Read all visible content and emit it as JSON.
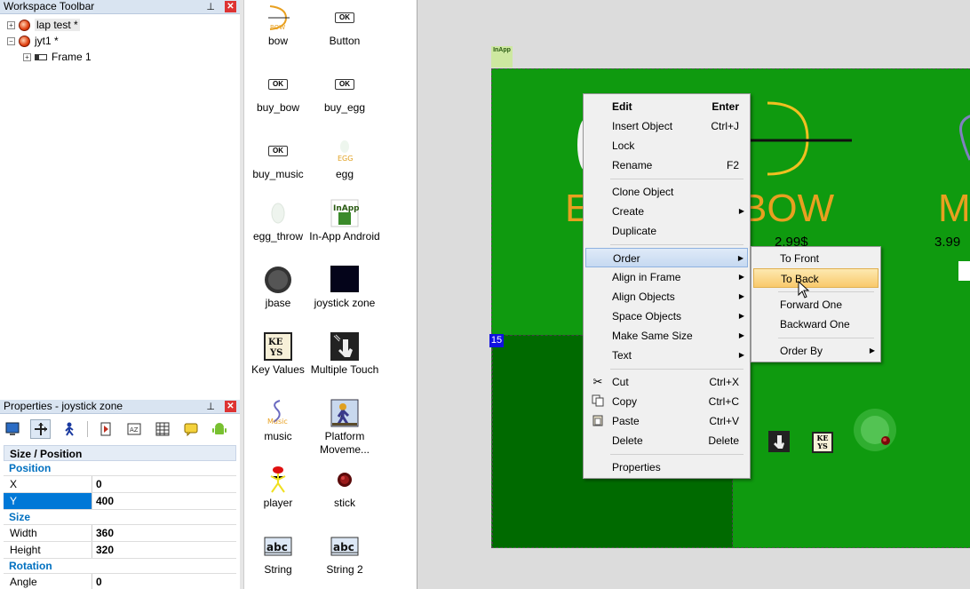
{
  "workspace": {
    "title": "Workspace Toolbar",
    "pin": "⊥",
    "close": "✕",
    "tree": [
      {
        "label": "lap test *",
        "expander": "+"
      },
      {
        "label": "jyt1 *",
        "expander": "−"
      },
      {
        "label": "Frame 1",
        "expander": "+"
      }
    ]
  },
  "properties": {
    "title": "Properties - joystick zone",
    "header": "Size / Position",
    "sections": {
      "position": "Position",
      "size": "Size",
      "rotation": "Rotation"
    },
    "rows": {
      "x": {
        "name": "X",
        "value": "0"
      },
      "y": {
        "name": "Y",
        "value": "400"
      },
      "width": {
        "name": "Width",
        "value": "360"
      },
      "height": {
        "name": "Height",
        "value": "320"
      },
      "angle": {
        "name": "Angle",
        "value": "0"
      }
    }
  },
  "library": {
    "items": [
      {
        "label": "bow",
        "icon": "bow-icon"
      },
      {
        "label": "Button",
        "icon": "button-icon"
      },
      {
        "label": "buy_bow",
        "icon": "button-icon"
      },
      {
        "label": "buy_egg",
        "icon": "button-icon"
      },
      {
        "label": "buy_music",
        "icon": "button-icon"
      },
      {
        "label": "egg",
        "icon": "egg-icon"
      },
      {
        "label": "egg_throw",
        "icon": "egg-throw-icon"
      },
      {
        "label": "In-App Android",
        "icon": "in-app-icon"
      },
      {
        "label": "jbase",
        "icon": "jbase-icon"
      },
      {
        "label": "joystick zone",
        "icon": "joystick-zone-icon"
      },
      {
        "label": "Key Values",
        "icon": "key-values-icon"
      },
      {
        "label": "Multiple Touch",
        "icon": "multiple-touch-icon"
      },
      {
        "label": "music",
        "icon": "music-icon"
      },
      {
        "label": "Platform Moveme...",
        "icon": "platform-movement-icon"
      },
      {
        "label": "player",
        "icon": "player-icon"
      },
      {
        "label": "stick",
        "icon": "stick-icon"
      },
      {
        "label": "String",
        "icon": "string-icon"
      },
      {
        "label": "String 2",
        "icon": "string-icon"
      }
    ],
    "icon_text": {
      "ok": "OK",
      "bow": "BOW",
      "egg": "EGG",
      "music": "Music",
      "keys": "KE YS",
      "abc": "abc",
      "inapp": "InApp"
    }
  },
  "canvas": {
    "zone_badge": "15",
    "inapp_badge": "InApp",
    "labels": {
      "left": "E",
      "bow": "BOW",
      "music": "M"
    },
    "prices": {
      "bow": "2.99$",
      "music": "3.99"
    },
    "keys_text": "KE YS",
    "colors": {
      "frame": "#0f9a0f",
      "zone": "#006a00",
      "label": "#e8a020"
    }
  },
  "context_menu": {
    "items": {
      "edit": {
        "label": "Edit",
        "shortcut": "Enter"
      },
      "insert_object": {
        "label": "Insert Object",
        "shortcut": "Ctrl+J"
      },
      "lock": {
        "label": "Lock"
      },
      "rename": {
        "label": "Rename",
        "shortcut": "F2"
      },
      "clone_object": {
        "label": "Clone Object"
      },
      "create": {
        "label": "Create"
      },
      "duplicate": {
        "label": "Duplicate"
      },
      "order": {
        "label": "Order"
      },
      "align_in_frame": {
        "label": "Align in Frame"
      },
      "align_objects": {
        "label": "Align Objects"
      },
      "space_objects": {
        "label": "Space Objects"
      },
      "make_same_size": {
        "label": "Make Same Size"
      },
      "text": {
        "label": "Text"
      },
      "cut": {
        "label": "Cut",
        "shortcut": "Ctrl+X"
      },
      "copy": {
        "label": "Copy",
        "shortcut": "Ctrl+C"
      },
      "paste": {
        "label": "Paste",
        "shortcut": "Ctrl+V"
      },
      "delete": {
        "label": "Delete",
        "shortcut": "Delete"
      },
      "properties": {
        "label": "Properties"
      }
    },
    "submenu_arrow": "▶"
  },
  "order_submenu": {
    "items": {
      "to_front": "To Front",
      "to_back": "To Back",
      "forward_one": "Forward One",
      "backward_one": "Backward One",
      "order_by": "Order By"
    }
  }
}
